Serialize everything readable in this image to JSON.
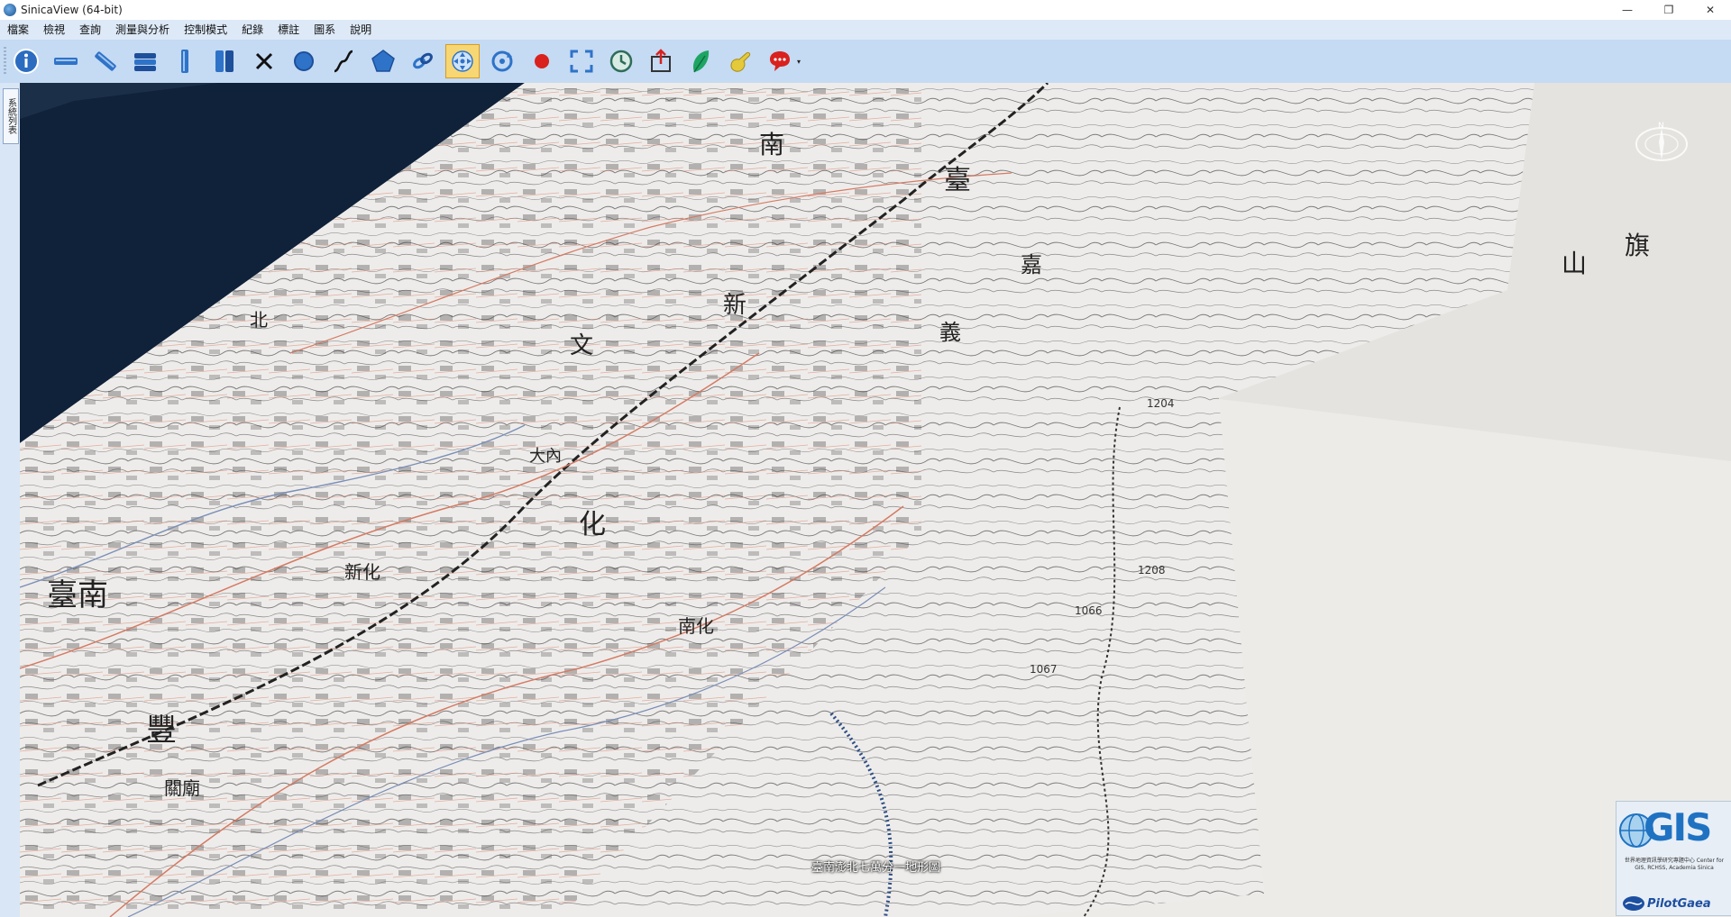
{
  "window": {
    "title": "SinicaView (64-bit)",
    "controls": {
      "minimize": "—",
      "restore": "❐",
      "close": "✕"
    }
  },
  "menu": {
    "items": [
      "檔案",
      "檢視",
      "查詢",
      "測量與分析",
      "控制模式",
      "紀錄",
      "標註",
      "圖系",
      "說明"
    ]
  },
  "toolbar": {
    "buttons": [
      {
        "name": "info-icon",
        "color": "#2b6cc0"
      },
      {
        "name": "horizontal-ruler-icon",
        "color": "#2e73c8"
      },
      {
        "name": "diagonal-ruler-icon",
        "color": "#2e73c8"
      },
      {
        "name": "layer-stack-icon",
        "color": "#1d4f9a"
      },
      {
        "name": "vertical-ruler-icon",
        "color": "#2e73c8"
      },
      {
        "name": "double-ruler-icon",
        "color": "#2e73c8"
      },
      {
        "name": "close-x-icon",
        "color": "#111111"
      },
      {
        "name": "circle-measure-icon",
        "color": "#2e73c8"
      },
      {
        "name": "curve-measure-icon",
        "color": "#111111"
      },
      {
        "name": "polygon-measure-icon",
        "color": "#2e73c8"
      },
      {
        "name": "link-icon",
        "color": "#2e73c8"
      },
      {
        "name": "pan-navigation-icon",
        "color": "#2e73c8",
        "active": true
      },
      {
        "name": "rotate-icon",
        "color": "#2e73c8"
      },
      {
        "name": "record-icon",
        "color": "#d9211e"
      },
      {
        "name": "fullscreen-icon",
        "color": "#2e73c8"
      },
      {
        "name": "history-clock-icon",
        "color": "#2e6d5a"
      },
      {
        "name": "export-icon",
        "color": "#333333"
      },
      {
        "name": "leaf-icon",
        "color": "#1fa563"
      },
      {
        "name": "annotation-hand-icon",
        "color": "#e4c93a"
      },
      {
        "name": "comment-bubble-icon",
        "color": "#d9211e"
      }
    ],
    "dropdown_glyph": "▾"
  },
  "sidebar": {
    "tab_label": "系統列表"
  },
  "map": {
    "caption": "臺南澎北七萬分一地形圖",
    "compass_label": "N",
    "labels": [
      {
        "text": "臺"
      },
      {
        "text": "南"
      },
      {
        "text": "文"
      },
      {
        "text": "新"
      },
      {
        "text": "豐"
      },
      {
        "text": "化"
      },
      {
        "text": "嘉"
      },
      {
        "text": "義"
      },
      {
        "text": "山"
      },
      {
        "text": "旗"
      },
      {
        "text": "北"
      },
      {
        "text": "新化"
      },
      {
        "text": "臺南"
      },
      {
        "text": "大內"
      },
      {
        "text": "南化"
      },
      {
        "text": "關廟"
      },
      {
        "text": "1204"
      },
      {
        "text": "1208"
      },
      {
        "text": "1066"
      },
      {
        "text": "1067"
      }
    ]
  },
  "logo": {
    "gis_text": "GIS",
    "sub_text": "世界地理資訊學研究專題中心 Center for GIS, RCHSS, Academia Sinica",
    "pilot_text": "PilotGaea"
  }
}
